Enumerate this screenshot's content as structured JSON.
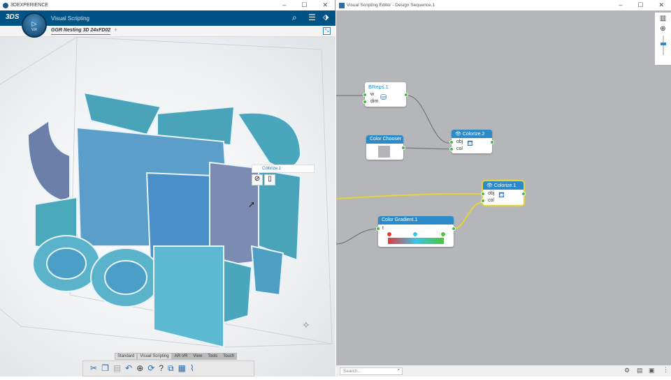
{
  "left_window": {
    "title": "3DEXPERIENCE",
    "app_name": "Visual Scripting",
    "tab": "GGR Nesting 3D 24xFD02",
    "compass_label": "V.R",
    "tooltip": {
      "label": "Colorize.1"
    }
  },
  "toolbar": {
    "tabs": [
      "Standard",
      "Visual Scripting",
      "AR-VR",
      "View",
      "Tools",
      "Touch"
    ]
  },
  "right_window": {
    "title": "Visual Scripting Editor - Design Sequence.1",
    "search_placeholder": "Search..."
  },
  "nodes": {
    "breps": {
      "title": "BReps.1",
      "ports": [
        "w",
        "dim"
      ]
    },
    "chooser": {
      "title": "Color Chooser",
      "swatch": "#b4b3b5"
    },
    "colorize2": {
      "title": "Colorize.2",
      "ports": [
        "obj",
        "col"
      ]
    },
    "colorize1": {
      "title": "Colorize.1",
      "ports": [
        "obj",
        "col"
      ]
    },
    "gradient": {
      "title": "Color Gradient.1",
      "ports": [
        "t"
      ],
      "stops": [
        "#e03b3b",
        "#3cc4e8",
        "#4cc43c"
      ]
    }
  },
  "colors": {
    "brand": "#005386",
    "node_header": "#2c8ac8",
    "port": "#4cb648",
    "selected_wire": "#e8d23a"
  }
}
